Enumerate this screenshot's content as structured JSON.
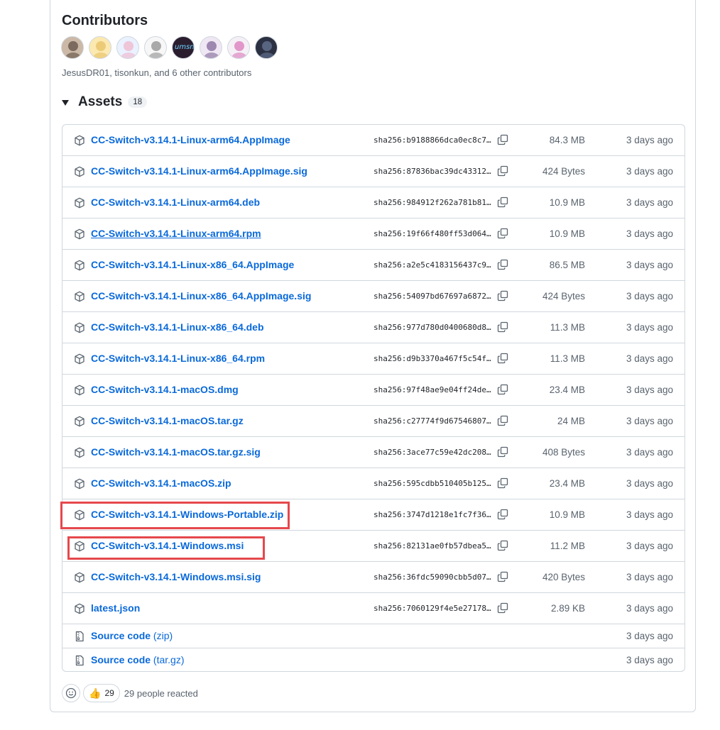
{
  "contributors": {
    "title": "Contributors",
    "summary": "JesusDR01, tisonkun, and 6 other contributors",
    "avatars": [
      {
        "bg": "#cbb8a6",
        "fg": "#3b2a20"
      },
      {
        "bg": "#fbe9b0",
        "fg": "#e0b24a"
      },
      {
        "bg": "#eaf1ff",
        "fg": "#f2a0b8"
      },
      {
        "bg": "#f7f7f7",
        "fg": "#6a6a6a"
      },
      {
        "bg": "#2a1d2e",
        "fg": "#6fd3ff",
        "text": "umsn"
      },
      {
        "bg": "#efe7f3",
        "fg": "#5b3b7a"
      },
      {
        "bg": "#f5f0f6",
        "fg": "#d04fa6"
      },
      {
        "bg": "#2b3142",
        "fg": "#7d8fb5"
      }
    ]
  },
  "assets": {
    "title": "Assets",
    "count": "18",
    "rows": [
      {
        "name": "CC-Switch-v3.14.1-Linux-arm64.AppImage",
        "sha": "sha256:b9188866dca0ec8c7…",
        "size": "84.3 MB",
        "date": "3 days ago"
      },
      {
        "name": "CC-Switch-v3.14.1-Linux-arm64.AppImage.sig",
        "sha": "sha256:87836bac39dc43312…",
        "size": "424 Bytes",
        "date": "3 days ago"
      },
      {
        "name": "CC-Switch-v3.14.1-Linux-arm64.deb",
        "sha": "sha256:984912f262a781b81…",
        "size": "10.9 MB",
        "date": "3 days ago"
      },
      {
        "name": "CC-Switch-v3.14.1-Linux-arm64.rpm",
        "sha": "sha256:19f66f480ff53d064…",
        "size": "10.9 MB",
        "date": "3 days ago",
        "hovered": true
      },
      {
        "name": "CC-Switch-v3.14.1-Linux-x86_64.AppImage",
        "sha": "sha256:a2e5c4183156437c9…",
        "size": "86.5 MB",
        "date": "3 days ago"
      },
      {
        "name": "CC-Switch-v3.14.1-Linux-x86_64.AppImage.sig",
        "sha": "sha256:54097bd67697a6872…",
        "size": "424 Bytes",
        "date": "3 days ago"
      },
      {
        "name": "CC-Switch-v3.14.1-Linux-x86_64.deb",
        "sha": "sha256:977d780d0400680d8…",
        "size": "11.3 MB",
        "date": "3 days ago"
      },
      {
        "name": "CC-Switch-v3.14.1-Linux-x86_64.rpm",
        "sha": "sha256:d9b3370a467f5c54f…",
        "size": "11.3 MB",
        "date": "3 days ago"
      },
      {
        "name": "CC-Switch-v3.14.1-macOS.dmg",
        "sha": "sha256:97f48ae9e04ff24de…",
        "size": "23.4 MB",
        "date": "3 days ago"
      },
      {
        "name": "CC-Switch-v3.14.1-macOS.tar.gz",
        "sha": "sha256:c27774f9d67546807…",
        "size": "24 MB",
        "date": "3 days ago"
      },
      {
        "name": "CC-Switch-v3.14.1-macOS.tar.gz.sig",
        "sha": "sha256:3ace77c59e42dc208…",
        "size": "408 Bytes",
        "date": "3 days ago"
      },
      {
        "name": "CC-Switch-v3.14.1-macOS.zip",
        "sha": "sha256:595cdbb510405b125…",
        "size": "23.4 MB",
        "date": "3 days ago"
      },
      {
        "name": "CC-Switch-v3.14.1-Windows-Portable.zip",
        "sha": "sha256:3747d1218e1fc7f36…",
        "size": "10.9 MB",
        "date": "3 days ago"
      },
      {
        "name": "CC-Switch-v3.14.1-Windows.msi",
        "sha": "sha256:82131ae0fb57dbea5…",
        "size": "11.2 MB",
        "date": "3 days ago"
      },
      {
        "name": "CC-Switch-v3.14.1-Windows.msi.sig",
        "sha": "sha256:36fdc59090cbb5d07…",
        "size": "420 Bytes",
        "date": "3 days ago"
      },
      {
        "name": "latest.json",
        "sha": "sha256:7060129f4e5e27178…",
        "size": "2.89 KB",
        "date": "3 days ago"
      }
    ],
    "source_rows": [
      {
        "name": "Source code",
        "suffix": "(zip)",
        "date": "3 days ago"
      },
      {
        "name": "Source code",
        "suffix": "(tar.gz)",
        "date": "3 days ago"
      }
    ]
  },
  "reactions": {
    "thumbs_count": "29",
    "summary": "29 people reacted"
  },
  "colors": {
    "link": "#0969da",
    "highlight": "#e5484d",
    "border": "#d0d7de",
    "muted": "#59636e"
  }
}
